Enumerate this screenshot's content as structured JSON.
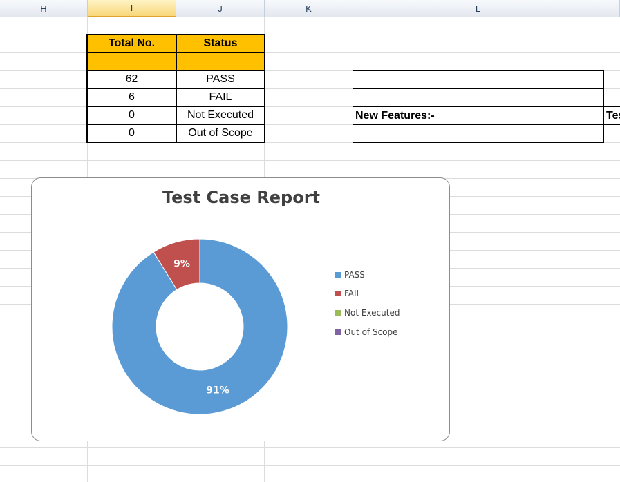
{
  "columns": {
    "h": "H",
    "i": "I",
    "j": "J",
    "k": "K",
    "l": "L"
  },
  "table": {
    "header_total": "Total No.",
    "header_status": "Status",
    "rows": [
      {
        "total": "62",
        "status": "PASS"
      },
      {
        "total": "6",
        "status": "FAIL"
      },
      {
        "total": "0",
        "status": "Not Executed"
      },
      {
        "total": "0",
        "status": "Out of Scope"
      }
    ]
  },
  "side": {
    "new_features": "New Features:-",
    "clipped_text": "Tes"
  },
  "chart_data": {
    "type": "pie",
    "title": "Test Case Report",
    "categories": [
      "PASS",
      "FAIL",
      "Not Executed",
      "Out of Scope"
    ],
    "values": [
      62,
      6,
      0,
      0
    ],
    "colors": [
      "#5b9bd5",
      "#c0504d",
      "#9bbb59",
      "#8064a2"
    ],
    "data_labels": [
      "91%",
      "9%",
      "",
      ""
    ],
    "donut": true,
    "legend": "right"
  }
}
